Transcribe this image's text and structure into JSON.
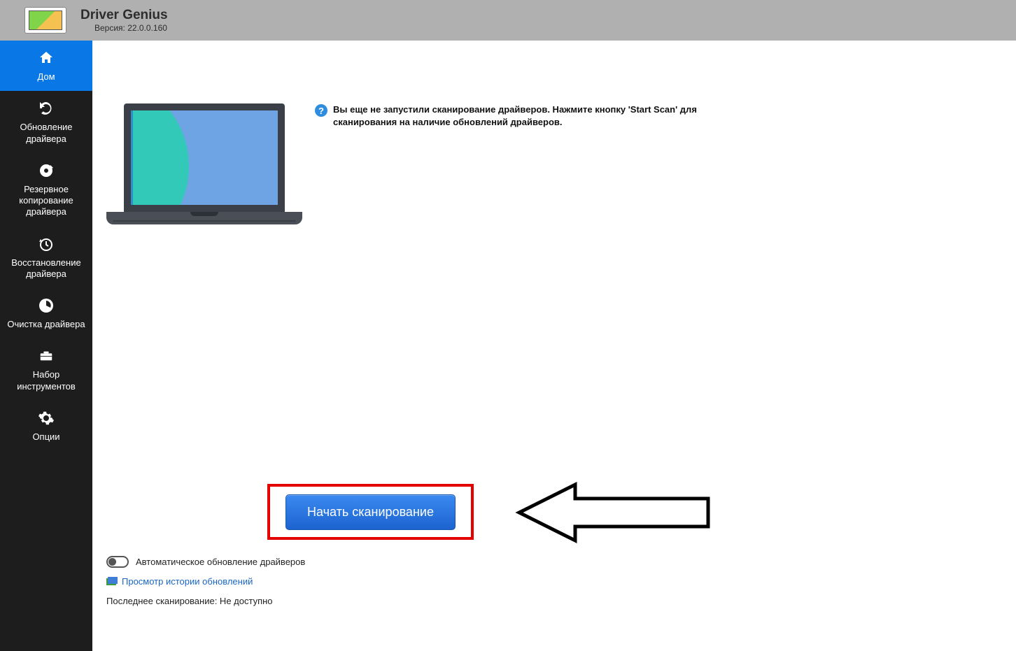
{
  "header": {
    "title": "Driver Genius",
    "version_label": "Версия: 22.0.0.160"
  },
  "sidebar": {
    "items": [
      {
        "label": "Дом",
        "icon": "home-icon"
      },
      {
        "label": "Обновление\nдрайвера",
        "icon": "refresh-icon"
      },
      {
        "label": "Резервное\nкопирование\nдрайвера",
        "icon": "disc-icon"
      },
      {
        "label": "Восстановление\nдрайвера",
        "icon": "restore-icon"
      },
      {
        "label": "Очистка драйвера",
        "icon": "clean-icon"
      },
      {
        "label": "Набор\nинструментов",
        "icon": "toolbox-icon"
      },
      {
        "label": "Опции",
        "icon": "gear-icon"
      }
    ]
  },
  "main": {
    "info_text": "Вы еще не запустили сканирование драйверов. Нажмите кнопку 'Start Scan' для сканирования на наличие обновлений драйверов.",
    "scan_button": "Начать  сканирование",
    "auto_update_label": "Автоматическое обновление драйверов",
    "history_link": "Просмотр истории обновлений",
    "last_scan_label": "Последнее сканирование: Не доступно"
  }
}
